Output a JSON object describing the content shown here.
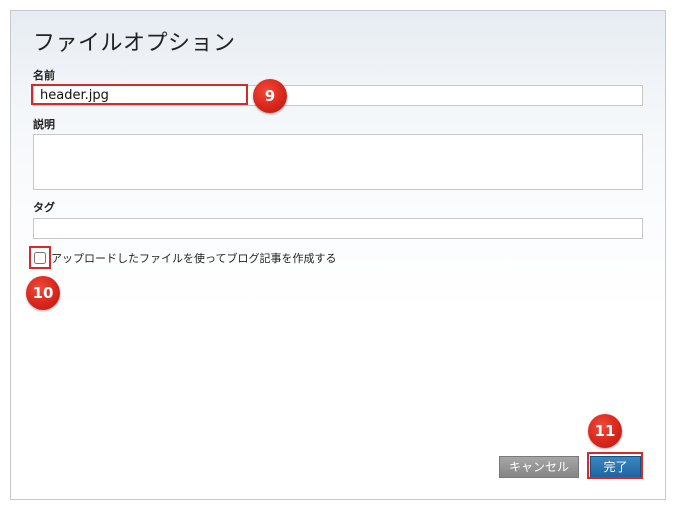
{
  "dialog": {
    "title": "ファイルオプション"
  },
  "fields": {
    "name_label": "名前",
    "name_value": "header.jpg",
    "description_label": "説明",
    "description_value": "",
    "tags_label": "タグ",
    "tags_value": ""
  },
  "options": {
    "create_entry_label": "アップロードしたファイルを使ってブログ記事を作成する",
    "create_entry_checked": false
  },
  "buttons": {
    "cancel_label": "キャンセル",
    "done_label": "完了"
  },
  "annotations": {
    "badge_name": "9",
    "badge_checkbox": "10",
    "badge_done": "11"
  },
  "colors": {
    "annotation_red": "#d42a2a",
    "done_button_blue": "#2670ad",
    "cancel_button_gray": "#969696"
  }
}
